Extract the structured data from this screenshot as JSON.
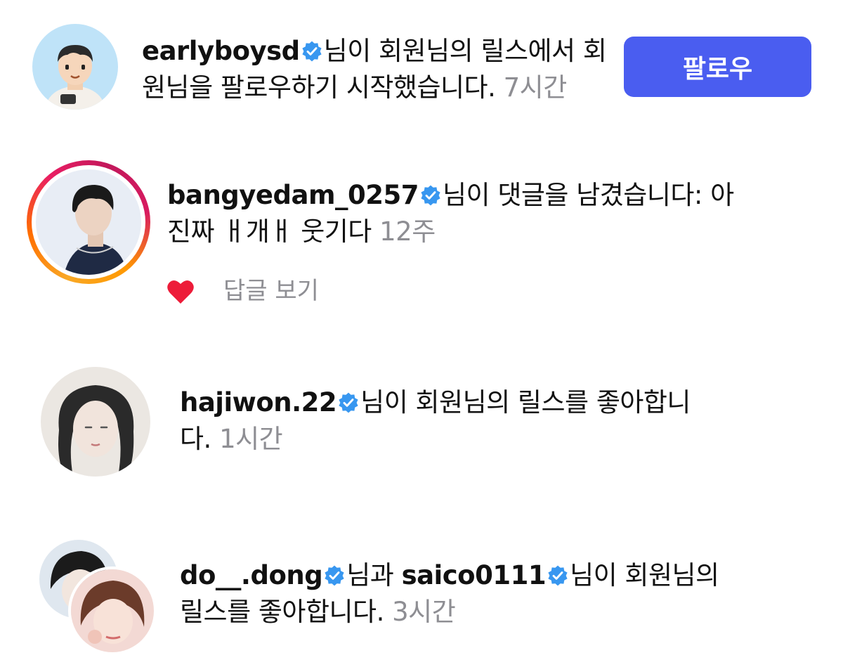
{
  "colors": {
    "accent": "#4a5df0",
    "verified": "#3897f0",
    "meta": "#8e8e93",
    "heart": "#ed1c39"
  },
  "notifications": [
    {
      "username": "earlyboysd",
      "avatar": "cartoon-boy-avatar",
      "line1": "님이 회원님의 릴스에서 회",
      "line2": "원님을 팔로우하기 시작했습니다.",
      "time": "7시간",
      "follow_label": "팔로우"
    },
    {
      "username": "bangyedam_0257",
      "avatar": "profile-photo-avatar",
      "story_ring": true,
      "line1": "님이 댓글을 남겼습니다: 아",
      "line2": "진짜 ㅐ개ㅐ 웃기다",
      "time": "12주",
      "heart_icon": "heart-icon",
      "reply_label": "답글 보기"
    },
    {
      "username": "hajiwon.22",
      "avatar": "profile-photo-avatar",
      "line1": "님이 회원님의 릴스를 좋아합니",
      "line2": "다.",
      "time": "1시간"
    },
    {
      "username": "do__.dong",
      "username2": "saico0111",
      "avatar": "stacked-profile-avatars",
      "joiner": "님과",
      "line1": "님이 회원님의",
      "line2": "릴스를 좋아합니다.",
      "time": "3시간"
    }
  ]
}
